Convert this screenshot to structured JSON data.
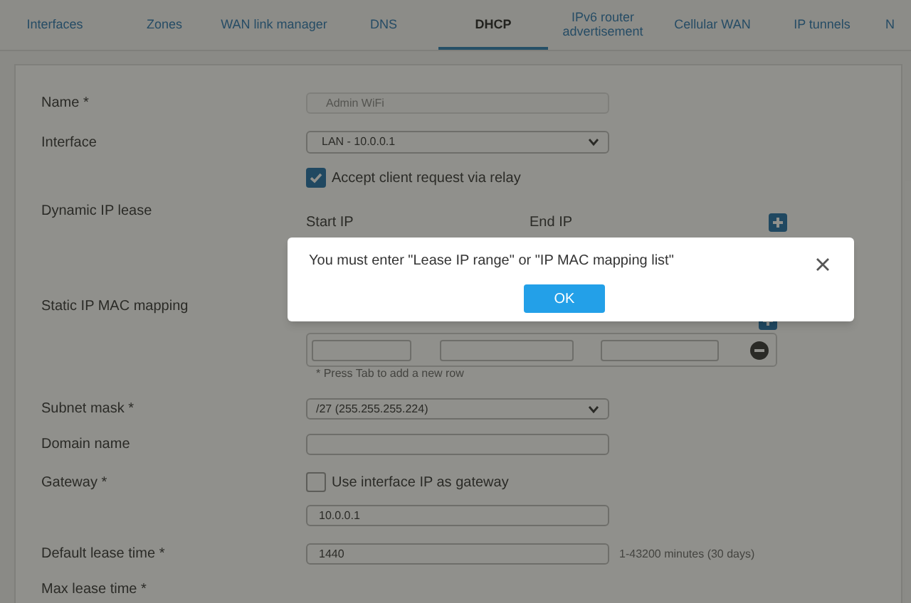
{
  "tabs": [
    {
      "label": "Interfaces",
      "selected": false
    },
    {
      "label": "Zones",
      "selected": false
    },
    {
      "label": "WAN link manager",
      "selected": false
    },
    {
      "label": "DNS",
      "selected": false
    },
    {
      "label": "DHCP",
      "selected": true
    },
    {
      "label": "IPv6 router advertisement",
      "selected": false
    },
    {
      "label": "Cellular WAN",
      "selected": false
    },
    {
      "label": "IP tunnels",
      "selected": false
    },
    {
      "label": "N",
      "selected": false
    }
  ],
  "form": {
    "name": {
      "label": "Name *",
      "value": "Admin WiFi",
      "disabled": true
    },
    "interface": {
      "label": "Interface",
      "value": "LAN - 10.0.0.1"
    },
    "relay": {
      "label": "Accept client request via relay",
      "checked": true
    },
    "dynamic_ip_lease": {
      "label": "Dynamic IP lease",
      "columns": [
        "Start IP",
        "End IP"
      ]
    },
    "static_ip_mac_mapping": {
      "label": "Static IP MAC mapping",
      "hint": "* Press Tab to add a new row"
    },
    "subnet_mask": {
      "label": "Subnet mask *",
      "value": "/27 (255.255.255.224)"
    },
    "domain_name": {
      "label": "Domain name"
    },
    "gateway": {
      "label": "Gateway *",
      "checkbox_label": "Use interface IP as gateway",
      "checked": false,
      "value": "10.0.0.1"
    },
    "default_lease_time": {
      "label": "Default lease time *",
      "value": "1440",
      "hint": "1-43200 minutes (30 days)"
    },
    "max_lease_time": {
      "label": "Max lease time *"
    }
  },
  "dialog": {
    "message": "You must enter \"Lease IP range\" or \"IP MAC mapping list\"",
    "button": "OK"
  }
}
